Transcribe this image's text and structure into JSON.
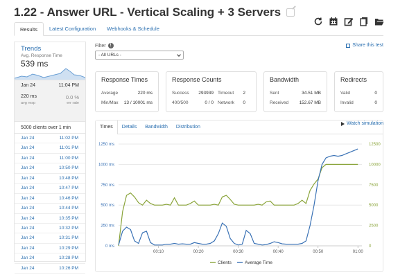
{
  "page": {
    "title": "1.22 - Answer URL - Vertical Scaling + 3 Servers"
  },
  "toolbar": {
    "icons": [
      "refresh-icon",
      "calendar-icon",
      "edit-icon",
      "copy-icon",
      "folder-icon"
    ]
  },
  "tabs": [
    {
      "label": "Results",
      "active": true
    },
    {
      "label": "Latest Configuration",
      "active": false
    },
    {
      "label": "Webhooks & Schedule",
      "active": false
    }
  ],
  "sidebar": {
    "trends_title": "Trends",
    "trends_subtitle": "Avg. Response Time",
    "trends_value": "539 ms",
    "selected": {
      "date": "Jan 24",
      "time": "11:04 PM",
      "avg_resp_value": "220 ms",
      "avg_resp_label": "avg resp",
      "err_rate_value": "0.0 %",
      "err_rate_label": "err rate"
    },
    "clients_text": "5000 clients over 1 min",
    "runs": [
      {
        "date": "Jan 24",
        "time": "11:02 PM"
      },
      {
        "date": "Jan 24",
        "time": "11:01 PM"
      },
      {
        "date": "Jan 24",
        "time": "11:00 PM"
      },
      {
        "date": "Jan 24",
        "time": "10:50 PM"
      },
      {
        "date": "Jan 24",
        "time": "10:48 PM"
      },
      {
        "date": "Jan 24",
        "time": "10:47 PM"
      },
      {
        "date": "Jan 24",
        "time": "10:46 PM"
      },
      {
        "date": "Jan 24",
        "time": "10:44 PM"
      },
      {
        "date": "Jan 24",
        "time": "10:35 PM"
      },
      {
        "date": "Jan 24",
        "time": "10:32 PM"
      },
      {
        "date": "Jan 24",
        "time": "10:31 PM"
      },
      {
        "date": "Jan 24",
        "time": "10:29 PM"
      },
      {
        "date": "Jan 24",
        "time": "10:28 PM"
      },
      {
        "date": "Jan 24",
        "time": "10:26 PM"
      }
    ]
  },
  "filter": {
    "label": "Filter",
    "info": "!",
    "selected": "- All URLs -"
  },
  "share_label": "Share this test",
  "cards": {
    "response_times": {
      "title": "Response Times",
      "avg_label": "Average",
      "avg_value": "220 ms",
      "minmax_label": "Min/Max",
      "minmax_value": "13 / 10001 ms"
    },
    "response_counts": {
      "title": "Response Counts",
      "success_label": "Success",
      "success_value": "293939",
      "timeout_label": "Timeout",
      "timeout_value": "2",
      "r400_label": "400/500",
      "r400_value": "0 / 0",
      "network_label": "Network",
      "network_value": "0"
    },
    "bandwidth": {
      "title": "Bandwidth",
      "sent_label": "Sent",
      "sent_value": "34.51 MB",
      "received_label": "Received",
      "received_value": "152.67 MB"
    },
    "redirects": {
      "title": "Redirects",
      "valid_label": "Valid",
      "valid_value": "0",
      "invalid_label": "Invalid",
      "invalid_value": "0"
    }
  },
  "chart_tabs": [
    {
      "label": "Times",
      "active": true
    },
    {
      "label": "Details",
      "active": false
    },
    {
      "label": "Bandwidth",
      "active": false
    },
    {
      "label": "Distribution",
      "active": false
    }
  ],
  "watch_label": "Watch simulation",
  "colors": {
    "clients": "#8aa43a",
    "avg_time": "#3a72b5",
    "link": "#2a6fb0"
  },
  "chart_data": {
    "type": "line",
    "x_ticks": [
      "00:10",
      "00:20",
      "00:30",
      "00:40",
      "00:50",
      "01:00"
    ],
    "y_left_ticks": [
      "0 ms",
      "250 ms",
      "500 ms",
      "750 ms",
      "1000 ms",
      "1250 ms"
    ],
    "y_right_ticks": [
      "0",
      "2500",
      "5000",
      "7500",
      "10000",
      "12500"
    ],
    "ylim_left": [
      0,
      1250
    ],
    "ylim_right": [
      0,
      12500
    ],
    "xlim": [
      0,
      61
    ],
    "legend_position": "bottom",
    "series": [
      {
        "name": "Clients",
        "axis": "right",
        "x": [
          0,
          1,
          2,
          3,
          4,
          5,
          6,
          7,
          8,
          9,
          10,
          11,
          12,
          13,
          14,
          15,
          16,
          17,
          18,
          19,
          20,
          21,
          22,
          23,
          24,
          25,
          26,
          27,
          28,
          29,
          30,
          31,
          32,
          33,
          34,
          35,
          36,
          37,
          38,
          39,
          40,
          41,
          42,
          43,
          44,
          45,
          46,
          47,
          48,
          49,
          50,
          51,
          52,
          53,
          54,
          55,
          56,
          57,
          58,
          59,
          60
        ],
        "values": [
          0,
          4200,
          6200,
          6500,
          6000,
          5300,
          5000,
          5600,
          5200,
          5000,
          5000,
          5000,
          5100,
          5000,
          5900,
          5000,
          5000,
          5000,
          5200,
          5500,
          5000,
          5000,
          5000,
          5000,
          5100,
          5000,
          6000,
          6200,
          5700,
          5100,
          5000,
          5000,
          5000,
          5000,
          5000,
          5100,
          5000,
          5400,
          5500,
          5000,
          5000,
          5000,
          5000,
          5000,
          5000,
          5200,
          5600,
          5200,
          6800,
          7600,
          8200,
          9600,
          10000,
          10000,
          10000,
          10000,
          10000,
          10000,
          10000,
          10000,
          10000
        ]
      },
      {
        "name": "Average Time",
        "axis": "left",
        "x": [
          0,
          1,
          2,
          3,
          4,
          5,
          6,
          7,
          8,
          9,
          10,
          11,
          12,
          13,
          14,
          15,
          16,
          17,
          18,
          19,
          20,
          21,
          22,
          23,
          24,
          25,
          26,
          27,
          28,
          29,
          30,
          31,
          32,
          33,
          34,
          35,
          36,
          37,
          38,
          39,
          40,
          41,
          42,
          43,
          44,
          45,
          46,
          47,
          48,
          49,
          50,
          51,
          52,
          53,
          54,
          55,
          56,
          57,
          58,
          59,
          60
        ],
        "values": [
          10,
          180,
          230,
          200,
          60,
          30,
          160,
          180,
          40,
          10,
          10,
          10,
          20,
          20,
          30,
          20,
          25,
          20,
          20,
          40,
          30,
          20,
          20,
          30,
          60,
          150,
          280,
          240,
          90,
          30,
          10,
          20,
          190,
          150,
          30,
          20,
          10,
          15,
          30,
          50,
          40,
          25,
          20,
          20,
          20,
          20,
          30,
          60,
          250,
          500,
          800,
          1000,
          1080,
          1100,
          1110,
          1100,
          1110,
          1130,
          1150,
          1170,
          1190
        ]
      }
    ]
  }
}
